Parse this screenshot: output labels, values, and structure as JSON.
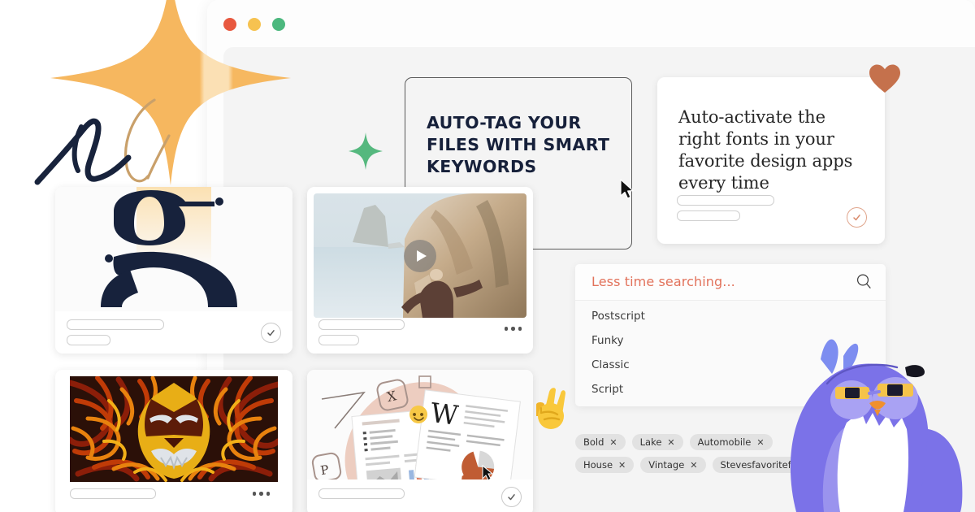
{
  "window": {
    "traffic_lights": [
      {
        "name": "close",
        "color": "#e8583f"
      },
      {
        "name": "minimize",
        "color": "#f6c250"
      },
      {
        "name": "maximize",
        "color": "#4cb87e"
      }
    ]
  },
  "callout": {
    "headline": "Auto-tag your files with smart keywords",
    "cursor_icon": "pointer-arrow-icon"
  },
  "promo_card": {
    "text": "Auto-activate the right fonts in your favorite design apps every time",
    "heart_icon": "heart-icon",
    "heart_color": "#c5714c",
    "check_icon": "check-circle-icon"
  },
  "search": {
    "placeholder": "Less time searching...",
    "placeholder_color": "#e2725b",
    "search_icon": "magnifier-icon",
    "options": [
      "Postscript",
      "Funky",
      "Classic",
      "Script"
    ]
  },
  "tags": {
    "remove_icon": "close-x-icon",
    "rows": [
      [
        "Bold",
        "Lake",
        "Automobile"
      ],
      [
        "House",
        "Vintage",
        "Stevesfavoritefonts"
      ]
    ]
  },
  "cards": [
    {
      "name": "glyph-card",
      "thumb": "letter-g-glyph",
      "glyph_color": "#17223c",
      "action_icon": "check-circle-icon",
      "bars": 2
    },
    {
      "name": "video-card",
      "thumb": "cliff-coast-photo",
      "play_icon": "play-button-icon",
      "action_icon": "more-options-icon",
      "bars": 2
    },
    {
      "name": "lion-card",
      "thumb": "flame-lion-illustration",
      "action_icon": "more-options-icon",
      "bars": 1
    },
    {
      "name": "documents-card",
      "thumb": "documents-illustration",
      "action_icon": "check-circle-icon",
      "bars": 1
    }
  ],
  "decor": {
    "orange_star": {
      "name": "orange-four-point-star",
      "color": "#f5b55f"
    },
    "green_star": {
      "name": "green-four-point-star",
      "color": "#55b87e"
    },
    "script_a": {
      "name": "script-letter-a",
      "color": "#17223c"
    },
    "script_l": {
      "name": "script-letter-l",
      "color": "#c9a06a"
    },
    "peace_hand": {
      "name": "victory-hand-emoji",
      "color": "#f8c33c"
    },
    "bird": {
      "name": "bird-mascot",
      "color": "#7b72e8"
    }
  }
}
